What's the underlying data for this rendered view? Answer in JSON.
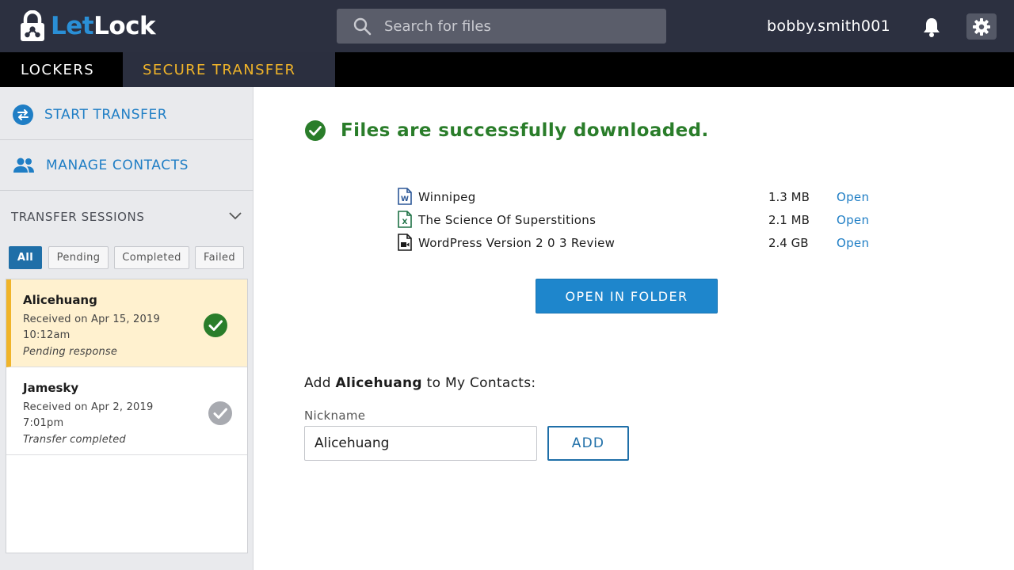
{
  "app": {
    "logo_part1": "Let",
    "logo_part2": "Lock",
    "logo_icon": "padlock-icon"
  },
  "header": {
    "search_placeholder": "Search for files",
    "username": "bobby.smith001",
    "notification_icon": "bell-icon",
    "settings_icon": "gear-icon"
  },
  "nav": {
    "tabs": [
      {
        "label": "LOCKERS",
        "active": false
      },
      {
        "label": "SECURE TRANSFER",
        "active": true
      }
    ]
  },
  "sidebar": {
    "actions": [
      {
        "label": "START TRANSFER",
        "icon": "transfer-arrows-icon"
      },
      {
        "label": "MANAGE CONTACTS",
        "icon": "contacts-icon"
      }
    ],
    "sessions_title": "TRANSFER SESSIONS",
    "filters": [
      {
        "label": "All",
        "active": true
      },
      {
        "label": "Pending",
        "active": false
      },
      {
        "label": "Completed",
        "active": false
      },
      {
        "label": "Failed",
        "active": false
      }
    ],
    "sessions": [
      {
        "name": "Alicehuang",
        "date": "Received on Apr 15, 2019",
        "time": "10:12am",
        "status": "Pending response",
        "selected": true,
        "check_color": "#2a7d2a"
      },
      {
        "name": "Jamesky",
        "date": "Received on Apr 2, 2019",
        "time": "7:01pm",
        "status": "Transfer completed",
        "selected": false,
        "check_color": "#a8aab0"
      }
    ]
  },
  "main": {
    "success_message": "Files are successfully downloaded.",
    "files": [
      {
        "name": "Winnipeg",
        "size": "1.3 MB",
        "open_label": "Open",
        "icon": "word-doc-icon"
      },
      {
        "name": "The Science Of Superstitions",
        "size": "2.1 MB",
        "open_label": "Open",
        "icon": "excel-doc-icon"
      },
      {
        "name": "WordPress Version 2 0 3 Review",
        "size": "2.4 GB",
        "open_label": "Open",
        "icon": "video-file-icon"
      }
    ],
    "open_folder_label": "OPEN IN FOLDER",
    "add_contact_prefix": "Add ",
    "add_contact_name": "Alicehuang",
    "add_contact_suffix": " to My Contacts:",
    "nickname_label": "Nickname",
    "nickname_value": "Alicehuang",
    "add_button_label": "ADD"
  },
  "colors": {
    "header_bg": "#2c3040",
    "accent_blue": "#1e86cc",
    "active_tab_text": "#f0b429",
    "success_green": "#2a7d2a",
    "selected_session_bg": "#fff1cf"
  }
}
